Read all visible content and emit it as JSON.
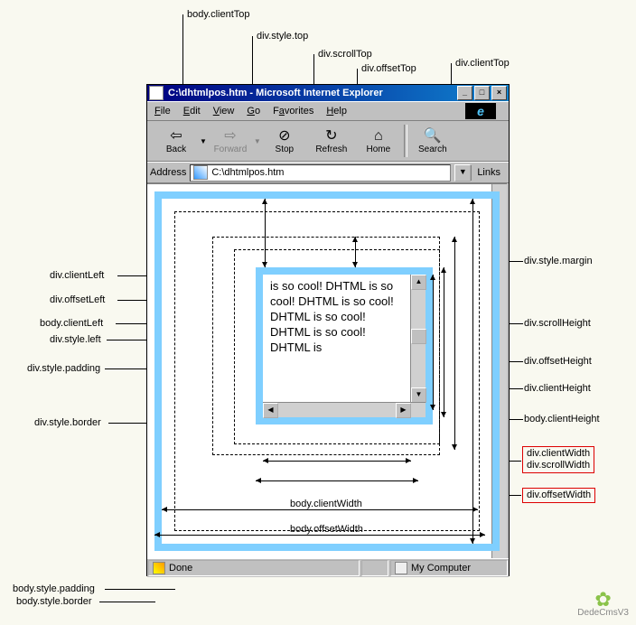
{
  "top_labels": {
    "body_clientTop": "body.clientTop",
    "div_style_top": "div.style.top",
    "div_scrollTop": "div.scrollTop",
    "div_offsetTop": "div.offsetTop",
    "div_clientTop": "div.clientTop"
  },
  "left_labels": {
    "div_clientLeft": "div.clientLeft",
    "div_offsetLeft": "div.offsetLeft",
    "body_clientLeft": "body.clientLeft",
    "div_style_left": "div.style.left",
    "div_style_padding": "div.style.padding",
    "div_style_border": "div.style.border",
    "body_style_padding": "body.style.padding",
    "body_style_border": "body.style.border"
  },
  "right_labels": {
    "div_style_margin": "div.style.margin",
    "div_scrollHeight": "div.scrollHeight",
    "div_offsetHeight": "div.offsetHeight",
    "div_clientHeight": "div.clientHeight",
    "body_clientHeight": "body.clientHeight",
    "div_clientWidth": "div.clientWidth",
    "div_scrollWidth": "div.scrollWidth",
    "div_offsetWidth": "div.offsetWidth"
  },
  "bottom_labels": {
    "body_clientWidth": "body.clientWidth",
    "body_offsetWidth": "body.offsetWidth"
  },
  "window": {
    "title": "C:\\dhtmlpos.htm - Microsoft Internet Explorer",
    "min": "_",
    "max": "□",
    "close": "×"
  },
  "menu": {
    "file": "File",
    "edit": "Edit",
    "view": "View",
    "go": "Go",
    "favorites": "Favorites",
    "help": "Help"
  },
  "toolbar": {
    "back": "Back",
    "forward": "Forward",
    "stop": "Stop",
    "refresh": "Refresh",
    "home": "Home",
    "search": "Search"
  },
  "addressbar": {
    "label": "Address",
    "value": "C:\\dhtmlpos.htm",
    "links": "Links"
  },
  "content": {
    "text": "is so cool! DHTML is so cool! DHTML is so cool! DHTML is so cool! DHTML is so cool! DHTML is"
  },
  "statusbar": {
    "done": "Done",
    "zone": "My Computer"
  },
  "watermark": "DedeCmsV3"
}
